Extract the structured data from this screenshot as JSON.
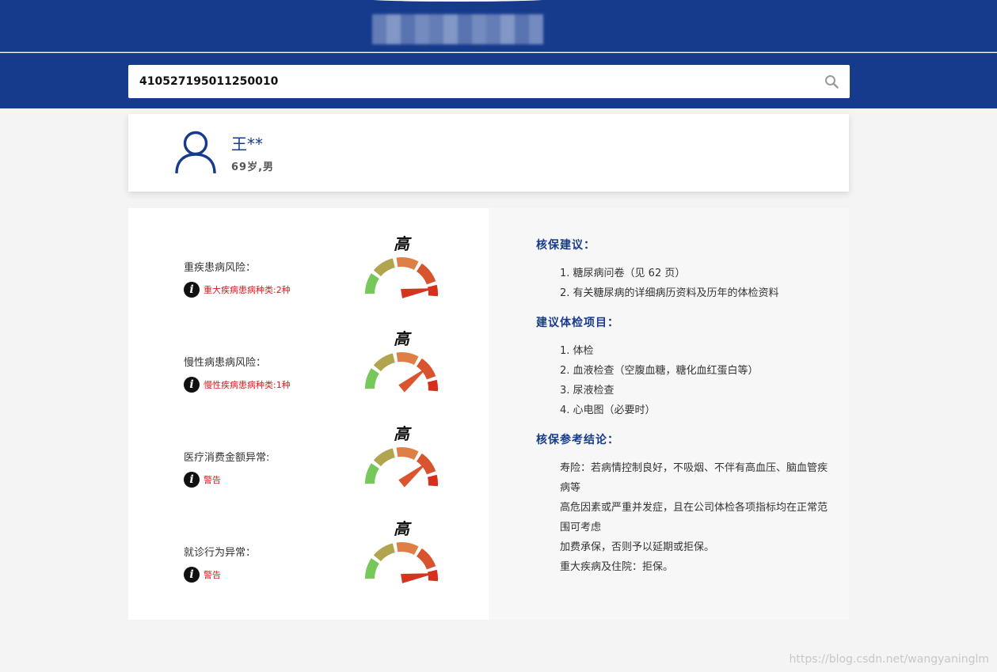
{
  "search": {
    "value": "410527195011250010"
  },
  "profile": {
    "name": "王**",
    "meta": "69岁,男"
  },
  "risks": [
    {
      "label": "重疾患病风险：",
      "note": "重大疾病患病种类:2种",
      "level_text": "高",
      "level": 0.95
    },
    {
      "label": "慢性病患病风险：",
      "note": "慢性疾病患病种类:1种",
      "level_text": "高",
      "level": 0.78
    },
    {
      "label": "医疗消费金额异常:",
      "note": "警告",
      "level_text": "高",
      "level": 0.78
    },
    {
      "label": "就诊行为异常：",
      "note": "警告",
      "level_text": "高",
      "level": 0.95
    }
  ],
  "advice": {
    "title": "核保建议：",
    "items": [
      "1. 糖尿病问卷（见 62 页）",
      "2. 有关糖尿病的详细病历资料及历年的体检资料"
    ]
  },
  "exam": {
    "title": "建议体检项目：",
    "items": [
      "1. 体检",
      "2. 血液检查（空腹血糖，糖化血红蛋白等）",
      "3. 尿液检查",
      "4. 心电图（必要时）"
    ]
  },
  "conclusion": {
    "title": "核保参考结论：",
    "lines": [
      "寿险：若病情控制良好，不吸烟、不伴有高血压、脑血管疾病等",
      "高危因素或严重并发症，且在公司体检各项指标均在正常范围可考虑",
      "加费承保，否则予以延期或拒保。",
      "重大疾病及住院：拒保。"
    ]
  },
  "watermark": "https://blog.csdn.net/wangyaninglm",
  "colors": {
    "brand": "#163b8c",
    "warning": "#d21f1f",
    "gauge_low": "#5cd65c",
    "gauge_mid": "#e08a4a",
    "gauge_high": "#d42a1a"
  }
}
